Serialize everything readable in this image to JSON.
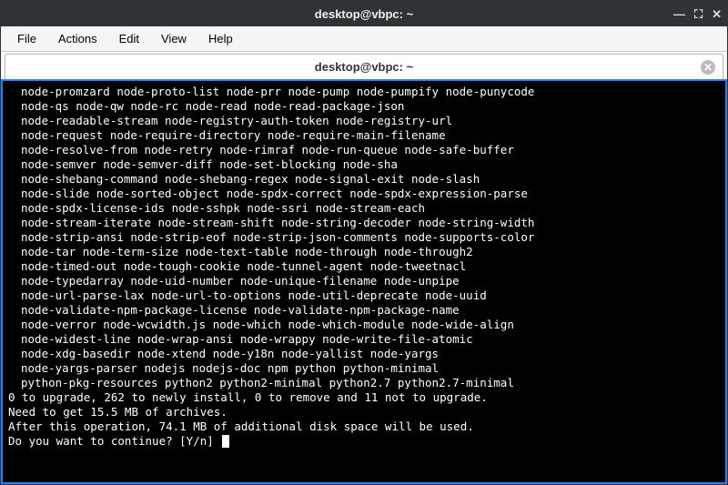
{
  "window": {
    "title": "desktop@vbpc: ~"
  },
  "menu": {
    "file": "File",
    "actions": "Actions",
    "edit": "Edit",
    "view": "View",
    "help": "Help"
  },
  "tab": {
    "title": "desktop@vbpc: ~"
  },
  "terminal": {
    "pkg_lines": [
      "node-promzard node-proto-list node-prr node-pump node-pumpify node-punycode",
      "node-qs node-qw node-rc node-read node-read-package-json",
      "node-readable-stream node-registry-auth-token node-registry-url",
      "node-request node-require-directory node-require-main-filename",
      "node-resolve-from node-retry node-rimraf node-run-queue node-safe-buffer",
      "node-semver node-semver-diff node-set-blocking node-sha",
      "node-shebang-command node-shebang-regex node-signal-exit node-slash",
      "node-slide node-sorted-object node-spdx-correct node-spdx-expression-parse",
      "node-spdx-license-ids node-sshpk node-ssri node-stream-each",
      "node-stream-iterate node-stream-shift node-string-decoder node-string-width",
      "node-strip-ansi node-strip-eof node-strip-json-comments node-supports-color",
      "node-tar node-term-size node-text-table node-through node-through2",
      "node-timed-out node-tough-cookie node-tunnel-agent node-tweetnacl",
      "node-typedarray node-uid-number node-unique-filename node-unpipe",
      "node-url-parse-lax node-url-to-options node-util-deprecate node-uuid",
      "node-validate-npm-package-license node-validate-npm-package-name",
      "node-verror node-wcwidth.js node-which node-which-module node-wide-align",
      "node-widest-line node-wrap-ansi node-wrappy node-write-file-atomic",
      "node-xdg-basedir node-xtend node-y18n node-yallist node-yargs",
      "node-yargs-parser nodejs nodejs-doc npm python python-minimal",
      "python-pkg-resources python2 python2-minimal python2.7 python2.7-minimal"
    ],
    "summary": "0 to upgrade, 262 to newly install, 0 to remove and 11 not to upgrade.",
    "need": "Need to get 15.5 MB of archives.",
    "after": "After this operation, 74.1 MB of additional disk space will be used.",
    "prompt": "Do you want to continue? [Y/n] "
  }
}
